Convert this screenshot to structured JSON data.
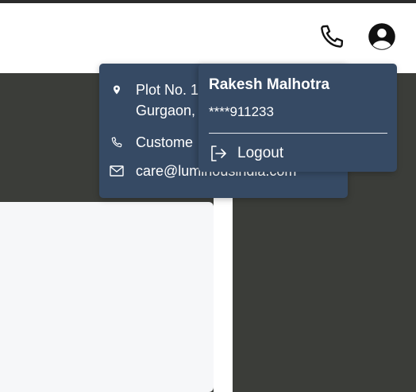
{
  "header": {
    "call_icon": "phone-icon",
    "account_icon": "user-circle-icon"
  },
  "contact_popover": {
    "address_line1": "Plot No. 1",
    "address_line2": "Gurgaon,",
    "customer_care": "Custome",
    "email": "care@luminousindia.com"
  },
  "user_menu": {
    "name": "Rakesh Malhotra",
    "phone": "****911233",
    "logout_label": "Logout"
  },
  "colors": {
    "popover_bg": "#364a64",
    "hero_bg": "#3b3d39",
    "card_bg": "#f6f7f9"
  }
}
